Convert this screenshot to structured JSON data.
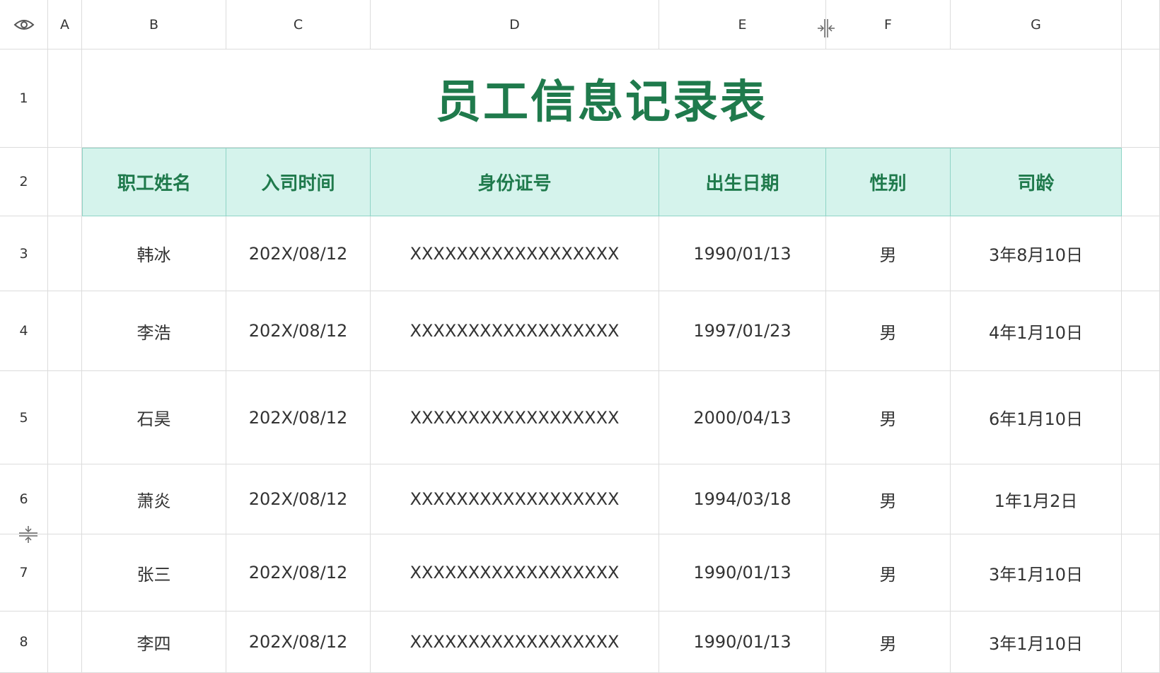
{
  "icons": {
    "visibility": "eye-icon",
    "column_resize": "column-resize-icon",
    "row_resize": "row-resize-icon"
  },
  "columns": [
    "A",
    "B",
    "C",
    "D",
    "E",
    "F",
    "G"
  ],
  "rows": [
    "1",
    "2",
    "3",
    "4",
    "5",
    "6",
    "7",
    "8"
  ],
  "title": "员工信息记录表",
  "headers": [
    "职工姓名",
    "入司时间",
    "身份证号",
    "出生日期",
    "性别",
    "司龄"
  ],
  "records": [
    [
      "韩冰",
      "202X/08/12",
      "XXXXXXXXXXXXXXXXXX",
      "1990/01/13",
      "男",
      "3年8月10日"
    ],
    [
      "李浩",
      "202X/08/12",
      "XXXXXXXXXXXXXXXXXX",
      "1997/01/23",
      "男",
      "4年1月10日"
    ],
    [
      "石昊",
      "202X/08/12",
      "XXXXXXXXXXXXXXXXXX",
      "2000/04/13",
      "男",
      "6年1月10日"
    ],
    [
      "萧炎",
      "202X/08/12",
      "XXXXXXXXXXXXXXXXXX",
      "1994/03/18",
      "男",
      "1年1月2日"
    ],
    [
      "张三",
      "202X/08/12",
      "XXXXXXXXXXXXXXXXXX",
      "1990/01/13",
      "男",
      "3年1月10日"
    ],
    [
      "李四",
      "202X/08/12",
      "XXXXXXXXXXXXXXXXXX",
      "1990/01/13",
      "男",
      "3年1月10日"
    ]
  ],
  "colors": {
    "title": "#1f7a4c",
    "header_bg": "#d5f3ec",
    "header_border": "#8fd4c6",
    "grid": "#dcdcdc"
  }
}
